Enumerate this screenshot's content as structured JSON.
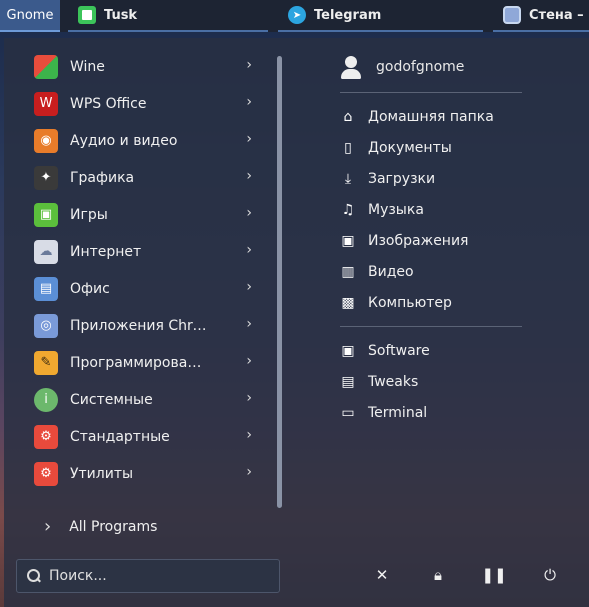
{
  "taskbar": {
    "start_label": "Gnome",
    "items": [
      {
        "label": "Tusk"
      },
      {
        "label": "Telegram"
      },
      {
        "label": "Стена –"
      }
    ]
  },
  "categories": [
    {
      "label": "Wine",
      "icon": "wine-icon",
      "color": "#e84d3c"
    },
    {
      "label": "WPS Office",
      "icon": "wps-office-icon",
      "color": "#c81e1e"
    },
    {
      "label": "Аудио и видео",
      "icon": "audio-video-icon",
      "color": "#e87c2a"
    },
    {
      "label": "Графика",
      "icon": "graphics-icon",
      "color": "#3a3a3a"
    },
    {
      "label": "Игры",
      "icon": "games-icon",
      "color": "#5bbf3c"
    },
    {
      "label": "Интернет",
      "icon": "internet-icon",
      "color": "#d8dce6"
    },
    {
      "label": "Офис",
      "icon": "office-icon",
      "color": "#5b8fd6"
    },
    {
      "label": "Приложения Chro…",
      "icon": "chrome-apps-icon",
      "color": "#7a9ad8"
    },
    {
      "label": "Программирование",
      "icon": "programming-icon",
      "color": "#f0a830"
    },
    {
      "label": "Системные",
      "icon": "system-icon",
      "color": "#6cb86c"
    },
    {
      "label": "Стандартные",
      "icon": "accessories-icon",
      "color": "#e84a3c"
    },
    {
      "label": "Утилиты",
      "icon": "utilities-icon",
      "color": "#e84a3c"
    }
  ],
  "all_programs_label": "All Programs",
  "search": {
    "placeholder": "Поиск..."
  },
  "user": {
    "name": "godofgnome"
  },
  "places": [
    {
      "label": "Домашняя папка",
      "icon": "home-icon"
    },
    {
      "label": "Документы",
      "icon": "document-icon"
    },
    {
      "label": "Загрузки",
      "icon": "download-icon"
    },
    {
      "label": "Музыка",
      "icon": "music-icon"
    },
    {
      "label": "Изображения",
      "icon": "image-icon"
    },
    {
      "label": "Видео",
      "icon": "video-icon"
    },
    {
      "label": "Компьютер",
      "icon": "computer-icon"
    }
  ],
  "apps": [
    {
      "label": "Software",
      "icon": "software-icon"
    },
    {
      "label": "Tweaks",
      "icon": "tweaks-icon"
    },
    {
      "label": "Terminal",
      "icon": "terminal-icon"
    }
  ],
  "power": [
    "close-icon",
    "lock-icon",
    "pause-icon",
    "power-icon"
  ]
}
